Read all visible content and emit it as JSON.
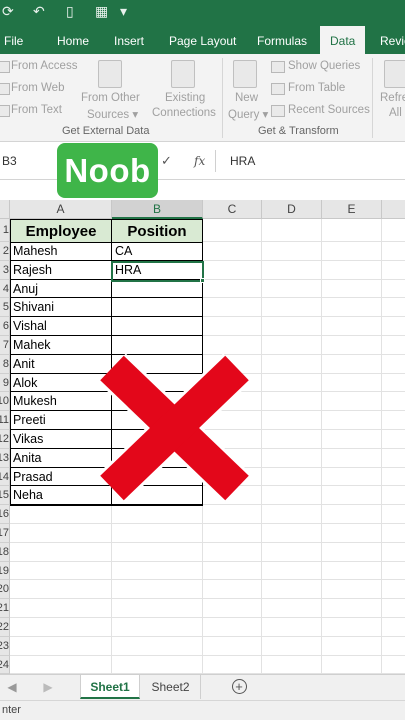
{
  "ribbon_tabs": {
    "file": "File",
    "home": "Home",
    "insert": "Insert",
    "page_layout": "Page Layout",
    "formulas": "Formulas",
    "data": "Data",
    "review": "Revie"
  },
  "ribbon": {
    "get_external": {
      "from_access": "From Access",
      "from_web": "From Web",
      "from_text": "From Text",
      "from_other_1": "From Other",
      "from_other_2": "Sources",
      "existing_1": "Existing",
      "existing_2": "Connections",
      "label": "Get External Data"
    },
    "get_transform": {
      "new_query_1": "New",
      "new_query_2": "Query",
      "show_queries": "Show Queries",
      "from_table": "From Table",
      "recent_sources": "Recent Sources",
      "label": "Get & Transform"
    },
    "refresh_1": "Refre",
    "refresh_2": "All"
  },
  "formula_bar": {
    "name_box": "B3",
    "fx": "fx",
    "formula": "HRA"
  },
  "badge": {
    "text": "Noob"
  },
  "columns": [
    "A",
    "B",
    "C",
    "D",
    "E"
  ],
  "table": {
    "headers": [
      "Employee",
      "Position"
    ],
    "rows": [
      [
        "Mahesh",
        "CA"
      ],
      [
        "Rajesh",
        "HRA"
      ],
      [
        "Anuj",
        ""
      ],
      [
        "Shivani",
        ""
      ],
      [
        "Vishal",
        ""
      ],
      [
        "Mahek",
        ""
      ],
      [
        "Anit",
        ""
      ],
      [
        "Alok",
        ""
      ],
      [
        "Mukesh",
        ""
      ],
      [
        "Preeti",
        ""
      ],
      [
        "Vikas",
        ""
      ],
      [
        "Anita",
        ""
      ],
      [
        "Prasad",
        ""
      ],
      [
        "Neha",
        ""
      ]
    ]
  },
  "row_numbers": [
    "1",
    "2",
    "3",
    "4",
    "5",
    "6",
    "7",
    "8",
    "9",
    "10",
    "11",
    "12",
    "13",
    "14",
    "15",
    "16",
    "17",
    "18",
    "19",
    "20",
    "21",
    "22",
    "23",
    "24"
  ],
  "sheets": {
    "sheet1": "Sheet1",
    "sheet2": "Sheet2",
    "add": "+"
  },
  "status": {
    "mode": "nter"
  },
  "colors": {
    "excel_green": "#217346",
    "header_fill": "#d9ead3",
    "badge_green": "#3fb549",
    "x_red": "#e3071a"
  }
}
